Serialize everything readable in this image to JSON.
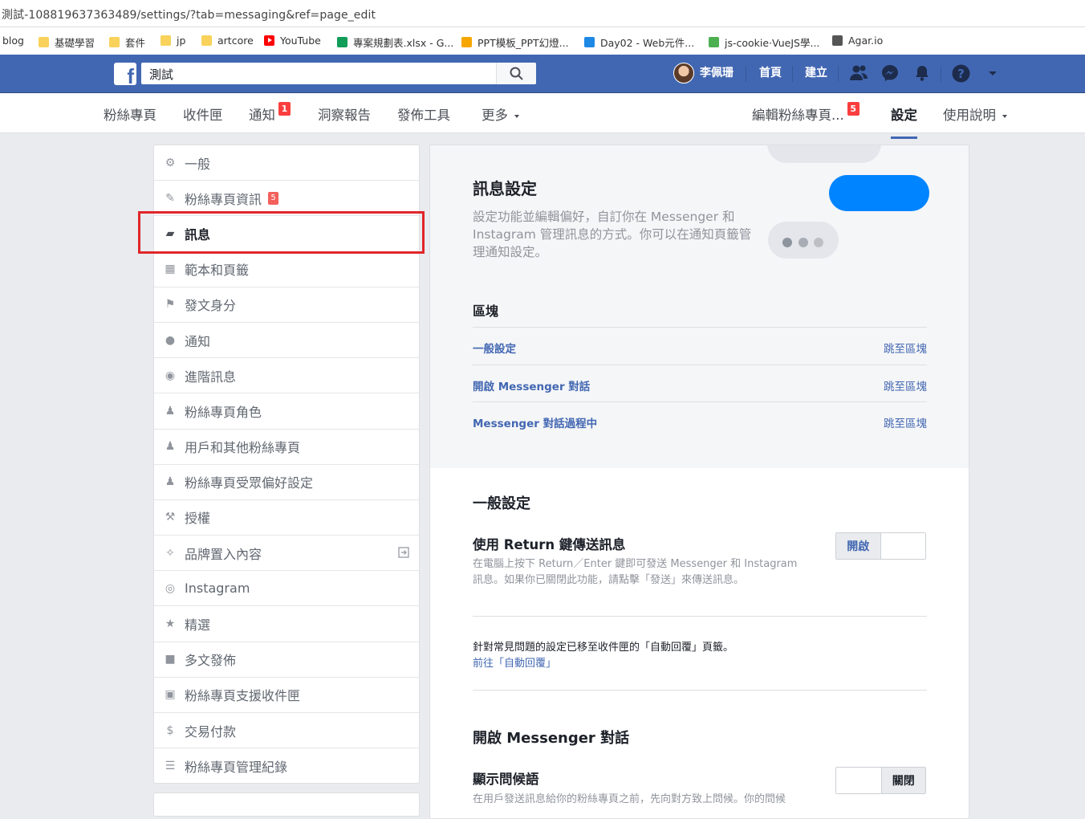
{
  "browser": {
    "url": "測試-108819637363489/settings/?tab=messaging&ref=page_edit",
    "bookmarks": [
      {
        "label": "blog",
        "icon": "none"
      },
      {
        "label": "基礎學習",
        "icon": "folder-icon"
      },
      {
        "label": "套件",
        "icon": "folder-icon"
      },
      {
        "label": "jp",
        "icon": "folder-icon"
      },
      {
        "label": "artcore",
        "icon": "folder-icon"
      },
      {
        "label": "YouTube",
        "icon": "youtube-icon"
      },
      {
        "label": "專案規劃表.xlsx - G...",
        "icon": "sheets-icon"
      },
      {
        "label": "PPT模板_PPT幻燈...",
        "icon": "ppt-icon"
      },
      {
        "label": "Day02 - Web元件...",
        "icon": "web-icon"
      },
      {
        "label": "js-cookie·VueJS學...",
        "icon": "cookie-icon"
      },
      {
        "label": "Agar.io",
        "icon": "agar-icon"
      }
    ]
  },
  "fb_header": {
    "search_value": "測試",
    "user_name": "李佩珊",
    "nav_home": "首頁",
    "nav_create": "建立",
    "accent_color": "#4267b2"
  },
  "page_tabs": {
    "items": [
      {
        "label": "粉絲專頁"
      },
      {
        "label": "收件匣"
      },
      {
        "label": "通知",
        "badge": "1"
      },
      {
        "label": "洞察報告"
      },
      {
        "label": "發佈工具"
      },
      {
        "label": "更多"
      }
    ],
    "edit_page": "編輯粉絲專頁...",
    "edit_badge": "5",
    "settings": "設定",
    "help": "使用說明"
  },
  "sidebar": {
    "items": [
      {
        "label": "一般",
        "icon": "gear-icon"
      },
      {
        "label": "粉絲專頁資訊",
        "icon": "pencil-icon",
        "badge": "5"
      },
      {
        "label": "訊息",
        "icon": "chat-icon",
        "active": true
      },
      {
        "label": "範本和頁籤",
        "icon": "grid-icon"
      },
      {
        "label": "發文身分",
        "icon": "flag-icon"
      },
      {
        "label": "通知",
        "icon": "globe-icon"
      },
      {
        "label": "進階訊息",
        "icon": "messenger-icon"
      },
      {
        "label": "粉絲專頁角色",
        "icon": "person-icon"
      },
      {
        "label": "用戶和其他粉絲專頁",
        "icon": "people-icon"
      },
      {
        "label": "粉絲專頁受眾偏好設定",
        "icon": "audience-icon"
      },
      {
        "label": "授權",
        "icon": "wrench-icon"
      },
      {
        "label": "品牌置入內容",
        "icon": "handshake-icon"
      },
      {
        "label": "Instagram",
        "icon": "instagram-icon"
      },
      {
        "label": "精選",
        "icon": "star-icon"
      },
      {
        "label": "多文發佈",
        "icon": "video-icon"
      },
      {
        "label": "粉絲專頁支援收件匣",
        "icon": "facebook-icon"
      },
      {
        "label": "交易付款",
        "icon": "dollar-icon"
      },
      {
        "label": "粉絲專頁管理紀錄",
        "icon": "list-icon"
      }
    ]
  },
  "main": {
    "hero_title": "訊息設定",
    "hero_desc": "設定功能並編輯偏好，自訂你在 Messenger 和 Instagram 管理訊息的方式。你可以在通知頁籤管理通知設定。",
    "blocks_title": "區塊",
    "blocks": [
      {
        "label": "一般設定",
        "jump": "跳至區塊"
      },
      {
        "label": "開啟 Messenger 對話",
        "jump": "跳至區塊"
      },
      {
        "label": "Messenger 對話過程中",
        "jump": "跳至區塊"
      }
    ],
    "general_title": "一般設定",
    "return_title": "使用 Return 鍵傳送訊息",
    "return_desc": "在電腦上按下 Return／Enter 鍵即可發送 Messenger 和 Instagram 訊息。如果你已關閉此功能，請點擊「發送」來傳送訊息。",
    "return_toggle_on": "開啟",
    "faq_note": "針對常見問題的設定已移至收件匣的「自動回覆」頁籤。",
    "faq_link": "前往「自動回覆」",
    "open_title": "開啟 Messenger 對話",
    "greeting_title": "顯示問候語",
    "greeting_desc": "在用戶發送訊息給你的粉絲專頁之前，先向對方致上問候。你的問候",
    "greeting_toggle_off": "關閉",
    "messenger_blue": "#0084ff"
  }
}
